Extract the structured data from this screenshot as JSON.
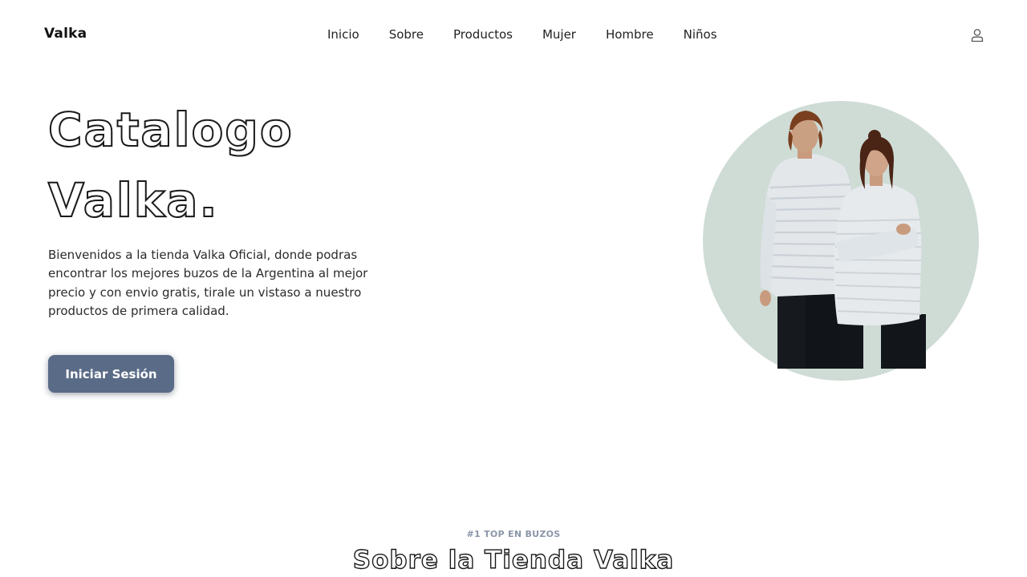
{
  "header": {
    "brand": "Valka",
    "nav": [
      "Inicio",
      "Sobre",
      "Productos",
      "Mujer",
      "Hombre",
      "Niños"
    ],
    "user_icon": "user-icon"
  },
  "hero": {
    "title_line1": "Catalogo",
    "title_line2": "Valka.",
    "description": "Bienvenidos a la tienda Valka Oficial, donde podras encontrar los mejores buzos de la Argentina al mejor precio y con envio gratis, tirale un vistaso a nuestro productos de primera calidad.",
    "cta_label": "Iniciar Sesión",
    "image_bg_color": "#cfdcd6"
  },
  "about": {
    "kicker": "#1 TOP EN BUZOS",
    "title": "Sobre la Tienda Valka"
  },
  "colors": {
    "button": "#5a6b87",
    "kicker": "#8b96a8"
  }
}
